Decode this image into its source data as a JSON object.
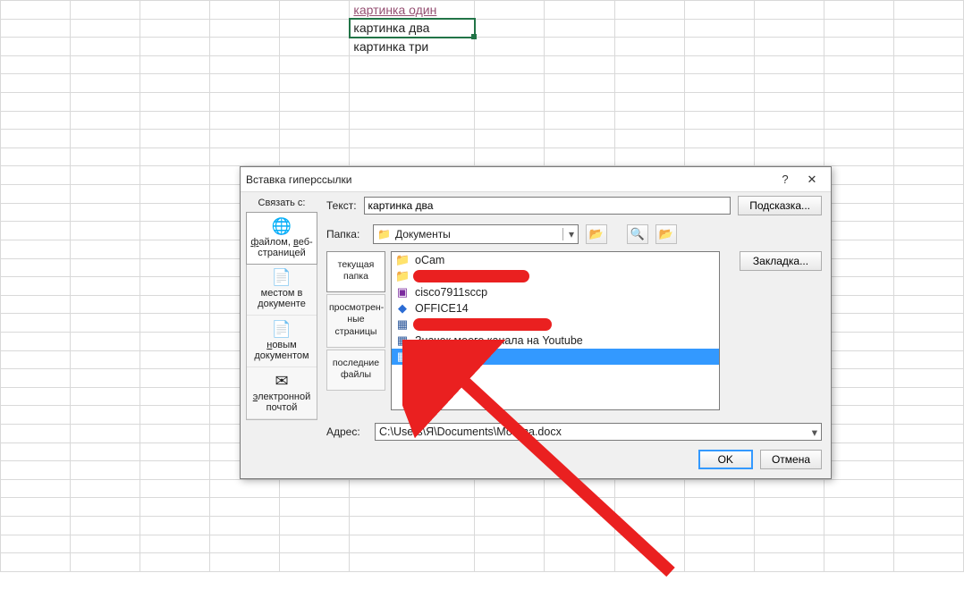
{
  "cells": {
    "link1": "картинка один",
    "selected": "картинка два",
    "text3": "картинка три"
  },
  "dialog": {
    "title": "Вставка гиперссылки",
    "help_glyph": "?",
    "close_glyph": "✕",
    "link_with_label": "Связать с:",
    "link_with": [
      {
        "icon": "🌐",
        "label": "файлом, веб-страницей"
      },
      {
        "icon": "📄",
        "label": "местом в документе"
      },
      {
        "icon": "📄",
        "label": "новым документом"
      },
      {
        "icon": "✉",
        "label": "электронной почтой"
      }
    ],
    "text_label": "Текст:",
    "text_value": "картинка два",
    "tip_button": "Подсказка...",
    "folder_label": "Папка:",
    "folder_value": "Документы",
    "browse_tabs": {
      "current": "текущая папка",
      "browsed": "просмотрен-ные страницы",
      "recent": "последние файлы"
    },
    "files": [
      {
        "icon": "folder",
        "name": "oCam"
      },
      {
        "icon": "folder",
        "name": "",
        "redacted": true
      },
      {
        "icon": "arch",
        "name": "cisco7911sccp"
      },
      {
        "icon": "blue",
        "name": "OFFICE14"
      },
      {
        "icon": "word",
        "name": "",
        "redacted": true
      },
      {
        "icon": "word",
        "name": "Значок моего канала на Youtube"
      },
      {
        "icon": "word",
        "name": "Москва",
        "selected": true
      }
    ],
    "bookmark_button": "Закладка...",
    "address_label": "Адрес:",
    "address_value": "C:\\Users\\Я\\Documents\\Москва.docx",
    "ok": "OK",
    "cancel": "Отмена"
  }
}
